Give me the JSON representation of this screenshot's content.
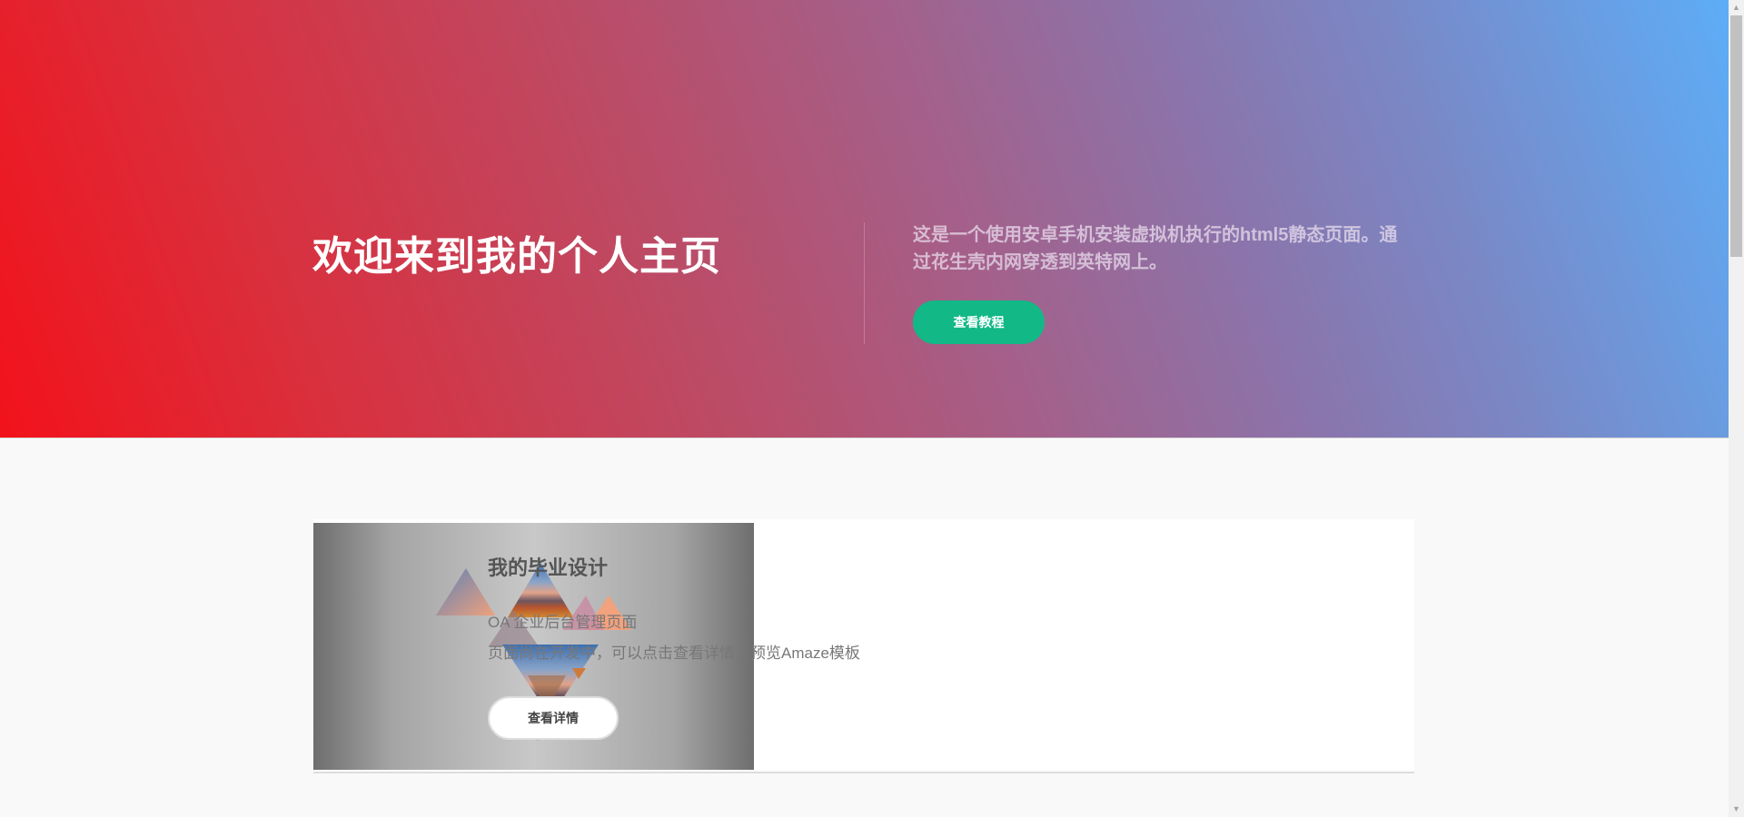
{
  "hero": {
    "title": "欢迎来到我的个人主页",
    "description": "这是一个使用安卓手机安装虚拟机执行的html5静态页面。通过花生壳内网穿透到英特网上。",
    "button_label": "查看教程"
  },
  "card": {
    "title": "我的毕业设计",
    "line1": "OA 企业后台管理页面",
    "line2": "页面尚在开发中，可以点击查看详情，预览Amaze模板",
    "button_label": "查看详情"
  },
  "colors": {
    "hero_gradient_start": "#f2121b",
    "hero_gradient_end": "#5dadf7",
    "primary_button": "#12b886",
    "page_background": "#f9f9f9"
  },
  "icons": {
    "scroll_up": "▲",
    "scroll_down": "▼"
  }
}
